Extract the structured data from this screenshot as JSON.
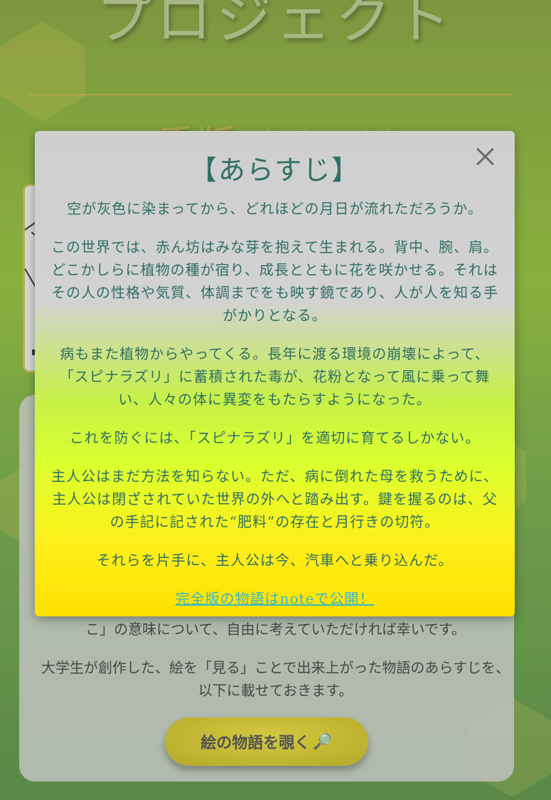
{
  "page": {
    "title": "プロジェクト",
    "section_heading": "重版イメージ"
  },
  "background_panel": {
    "paragraph1_tail": "こ」の意味について、自由に考えていただければ幸いです。",
    "paragraph2": "大学生が創作した、絵を「見る」ことで出来上がった物語のあらすじを、以下に載せておきます。",
    "cta_label": "絵の物語を覗く",
    "cta_icon": "🔎"
  },
  "modal": {
    "title": "【あらすじ】",
    "close_icon": "close-icon",
    "paragraphs": [
      "空が灰色に染まってから、どれほどの月日が流れただろうか。",
      "この世界では、赤ん坊はみな芽を抱えて生まれる。背中、腕、肩。どこかしらに植物の種が宿り、成長とともに花を咲かせる。それはその人の性格や気質、体調までをも映す鏡であり、人が人を知る手がかりとなる。",
      "病もまた植物からやってくる。長年に渡る環境の崩壊によって、「スピナラズリ」に蓄積された毒が、花粉となって風に乗って舞い、人々の体に異変をもたらすようになった。",
      "これを防ぐには、「スピナラズリ」を適切に育てるしかない。",
      "主人公はまだ方法を知らない。ただ、病に倒れた母を救うために、主人公は閉ざされていた世界の外へと踏み出す。鍵を握るのは、父の手記に記された“肥料”の存在と月行きの切符。",
      "それらを片手に、主人公は今、汽車へと乗り込んだ。"
    ],
    "link_label": "完全版の物語はnoteで公開！"
  },
  "colors": {
    "modal_text": "#2f6f65",
    "link": "#35b8c8",
    "accent_yellow": "#ffe000"
  }
}
